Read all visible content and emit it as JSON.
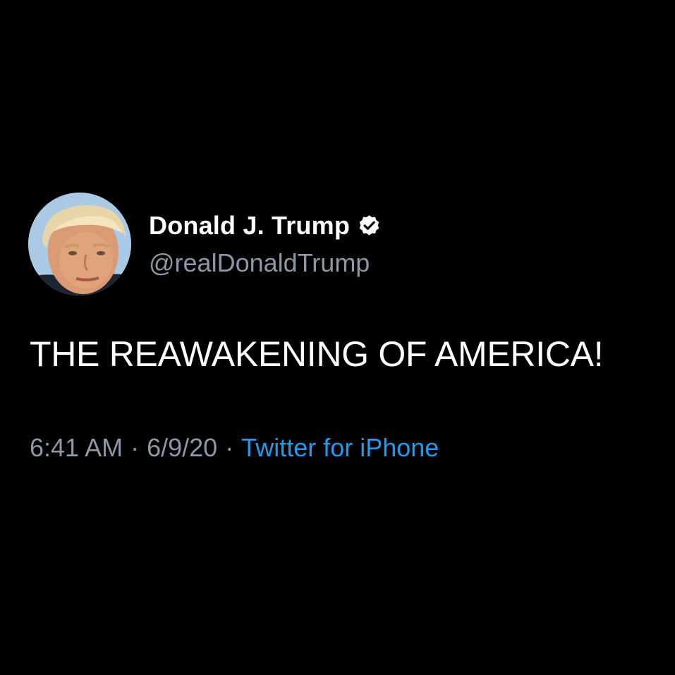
{
  "tweet": {
    "author": {
      "display_name": "Donald J. Trump",
      "handle": "@realDonaldTrump",
      "verified": true,
      "avatar_icon": "profile-photo"
    },
    "text": "THE REAWAKENING OF AMERICA!",
    "meta": {
      "time": "6:41 AM",
      "separator": "·",
      "date": "6/9/20",
      "source": "Twitter for iPhone"
    }
  },
  "colors": {
    "background": "#000000",
    "primary_text": "#ffffff",
    "secondary_text": "#8b98a5",
    "link": "#1d9bf0"
  }
}
